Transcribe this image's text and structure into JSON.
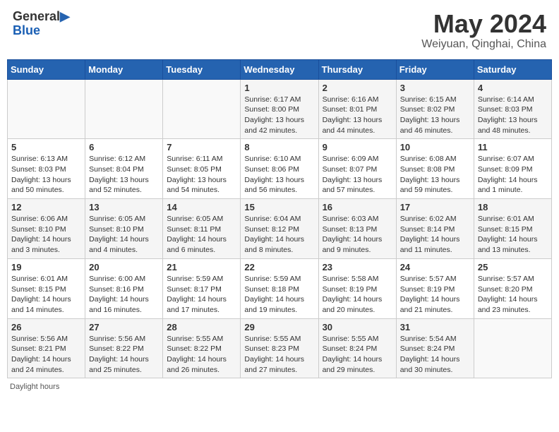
{
  "header": {
    "logo_line1": "General",
    "logo_line2": "Blue",
    "month": "May 2024",
    "location": "Weiyuan, Qinghai, China"
  },
  "weekdays": [
    "Sunday",
    "Monday",
    "Tuesday",
    "Wednesday",
    "Thursday",
    "Friday",
    "Saturday"
  ],
  "weeks": [
    [
      {
        "day": "",
        "info": ""
      },
      {
        "day": "",
        "info": ""
      },
      {
        "day": "",
        "info": ""
      },
      {
        "day": "1",
        "info": "Sunrise: 6:17 AM\nSunset: 8:00 PM\nDaylight: 13 hours\nand 42 minutes."
      },
      {
        "day": "2",
        "info": "Sunrise: 6:16 AM\nSunset: 8:01 PM\nDaylight: 13 hours\nand 44 minutes."
      },
      {
        "day": "3",
        "info": "Sunrise: 6:15 AM\nSunset: 8:02 PM\nDaylight: 13 hours\nand 46 minutes."
      },
      {
        "day": "4",
        "info": "Sunrise: 6:14 AM\nSunset: 8:03 PM\nDaylight: 13 hours\nand 48 minutes."
      }
    ],
    [
      {
        "day": "5",
        "info": "Sunrise: 6:13 AM\nSunset: 8:03 PM\nDaylight: 13 hours\nand 50 minutes."
      },
      {
        "day": "6",
        "info": "Sunrise: 6:12 AM\nSunset: 8:04 PM\nDaylight: 13 hours\nand 52 minutes."
      },
      {
        "day": "7",
        "info": "Sunrise: 6:11 AM\nSunset: 8:05 PM\nDaylight: 13 hours\nand 54 minutes."
      },
      {
        "day": "8",
        "info": "Sunrise: 6:10 AM\nSunset: 8:06 PM\nDaylight: 13 hours\nand 56 minutes."
      },
      {
        "day": "9",
        "info": "Sunrise: 6:09 AM\nSunset: 8:07 PM\nDaylight: 13 hours\nand 57 minutes."
      },
      {
        "day": "10",
        "info": "Sunrise: 6:08 AM\nSunset: 8:08 PM\nDaylight: 13 hours\nand 59 minutes."
      },
      {
        "day": "11",
        "info": "Sunrise: 6:07 AM\nSunset: 8:09 PM\nDaylight: 14 hours\nand 1 minute."
      }
    ],
    [
      {
        "day": "12",
        "info": "Sunrise: 6:06 AM\nSunset: 8:10 PM\nDaylight: 14 hours\nand 3 minutes."
      },
      {
        "day": "13",
        "info": "Sunrise: 6:05 AM\nSunset: 8:10 PM\nDaylight: 14 hours\nand 4 minutes."
      },
      {
        "day": "14",
        "info": "Sunrise: 6:05 AM\nSunset: 8:11 PM\nDaylight: 14 hours\nand 6 minutes."
      },
      {
        "day": "15",
        "info": "Sunrise: 6:04 AM\nSunset: 8:12 PM\nDaylight: 14 hours\nand 8 minutes."
      },
      {
        "day": "16",
        "info": "Sunrise: 6:03 AM\nSunset: 8:13 PM\nDaylight: 14 hours\nand 9 minutes."
      },
      {
        "day": "17",
        "info": "Sunrise: 6:02 AM\nSunset: 8:14 PM\nDaylight: 14 hours\nand 11 minutes."
      },
      {
        "day": "18",
        "info": "Sunrise: 6:01 AM\nSunset: 8:15 PM\nDaylight: 14 hours\nand 13 minutes."
      }
    ],
    [
      {
        "day": "19",
        "info": "Sunrise: 6:01 AM\nSunset: 8:15 PM\nDaylight: 14 hours\nand 14 minutes."
      },
      {
        "day": "20",
        "info": "Sunrise: 6:00 AM\nSunset: 8:16 PM\nDaylight: 14 hours\nand 16 minutes."
      },
      {
        "day": "21",
        "info": "Sunrise: 5:59 AM\nSunset: 8:17 PM\nDaylight: 14 hours\nand 17 minutes."
      },
      {
        "day": "22",
        "info": "Sunrise: 5:59 AM\nSunset: 8:18 PM\nDaylight: 14 hours\nand 19 minutes."
      },
      {
        "day": "23",
        "info": "Sunrise: 5:58 AM\nSunset: 8:19 PM\nDaylight: 14 hours\nand 20 minutes."
      },
      {
        "day": "24",
        "info": "Sunrise: 5:57 AM\nSunset: 8:19 PM\nDaylight: 14 hours\nand 21 minutes."
      },
      {
        "day": "25",
        "info": "Sunrise: 5:57 AM\nSunset: 8:20 PM\nDaylight: 14 hours\nand 23 minutes."
      }
    ],
    [
      {
        "day": "26",
        "info": "Sunrise: 5:56 AM\nSunset: 8:21 PM\nDaylight: 14 hours\nand 24 minutes."
      },
      {
        "day": "27",
        "info": "Sunrise: 5:56 AM\nSunset: 8:22 PM\nDaylight: 14 hours\nand 25 minutes."
      },
      {
        "day": "28",
        "info": "Sunrise: 5:55 AM\nSunset: 8:22 PM\nDaylight: 14 hours\nand 26 minutes."
      },
      {
        "day": "29",
        "info": "Sunrise: 5:55 AM\nSunset: 8:23 PM\nDaylight: 14 hours\nand 27 minutes."
      },
      {
        "day": "30",
        "info": "Sunrise: 5:55 AM\nSunset: 8:24 PM\nDaylight: 14 hours\nand 29 minutes."
      },
      {
        "day": "31",
        "info": "Sunrise: 5:54 AM\nSunset: 8:24 PM\nDaylight: 14 hours\nand 30 minutes."
      },
      {
        "day": "",
        "info": ""
      }
    ]
  ],
  "footer": "Daylight hours"
}
